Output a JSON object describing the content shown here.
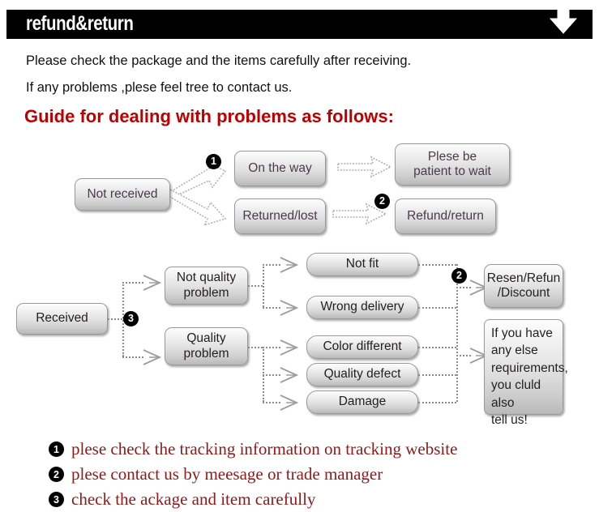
{
  "header": {
    "title": "refund&return",
    "arrow_icon": "down-arrow-icon"
  },
  "intro": {
    "line1": "Please check the package and the items carefully after receiving.",
    "line2": "If any problems ,plese feel tree to contact us.",
    "heading": "Guide for dealing with problems as follows:"
  },
  "flowchart_top": {
    "start": "Not received",
    "branch_a": "On the way",
    "branch_b": "Returned/lost",
    "result_a": "Plese be\npatient to wait",
    "result_a_line1": "Plese be",
    "result_a_line2": "patient to wait",
    "result_b": "Refund/return",
    "marker_1": "❶",
    "marker_2": "❷",
    "marker_1_num": "1",
    "marker_2_num": "2"
  },
  "flowchart_bottom": {
    "start": "Received",
    "marker_3_num": "3",
    "marker_2_num": "2",
    "category_a_line1": "Not quality",
    "category_a_line2": "problem",
    "category_b_line1": "Quality",
    "category_b_line2": "problem",
    "issues": [
      "Not fit",
      "Wrong delivery",
      "Color different",
      "Quality defect",
      "Damage"
    ],
    "outcome_line1": "Resen/Refun",
    "outcome_line2": "/Discount",
    "note_line1": "If you have",
    "note_line2": "any else",
    "note_line3": "requirements,",
    "note_line4": "you cluld also",
    "note_line5": "tell us!"
  },
  "footer": {
    "items": [
      {
        "num": "1",
        "text": "plese check the tracking information on tracking website"
      },
      {
        "num": "2",
        "text": "plese contact us by meesage or trade manager"
      },
      {
        "num": "3",
        "text": "check the ackage and item carefully"
      }
    ]
  },
  "colors": {
    "header_bg": "#000000",
    "heading_red": "#c00000",
    "footer_red": "#8e1a19",
    "node_text": "#231f20",
    "node_text_purple": "#4b3a4c",
    "connector": "#8c8c8c"
  }
}
